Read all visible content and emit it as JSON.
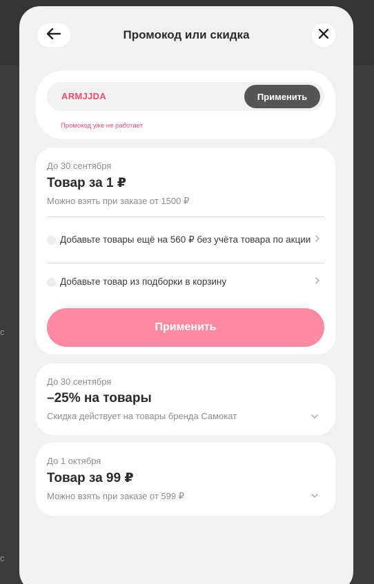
{
  "background": {
    "hint_char_1": "с",
    "hint_char_2": "с"
  },
  "header": {
    "title": "Промокод или скидка",
    "back_icon": "arrow-left-icon",
    "close_icon": "close-icon"
  },
  "promo": {
    "value": "ARMJJDA",
    "apply_label": "Применить",
    "error": "Промокод уже не работает"
  },
  "offers": [
    {
      "date": "До 30 сентября",
      "title": "Товар за 1 ₽",
      "description": "Можно взять при заказе от 1500 ₽",
      "conditions": [
        "Добавьте товары ещё на 560 ₽ без учёта товара по акции",
        "Добавьте товар из подборки в корзину"
      ],
      "apply_label": "Применить"
    },
    {
      "date": "До 30 сентября",
      "title": "–25% на товары",
      "description": "Скидка действует на товары бренда Самокат"
    },
    {
      "date": "До 1 октября",
      "title": "Товар за 99 ₽",
      "description": "Можно взять при заказе от 599 ₽"
    }
  ],
  "colors": {
    "accent": "#f04b6f",
    "apply_button": "#ff8aa2",
    "dark_button": "#555555"
  }
}
